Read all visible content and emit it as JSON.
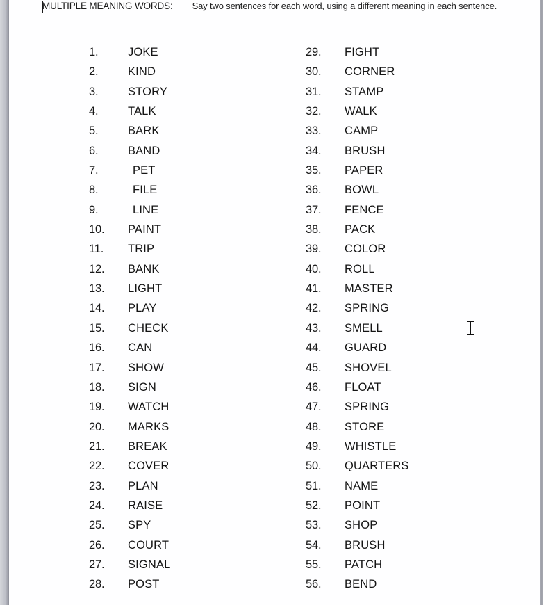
{
  "document": {
    "header": {
      "title": "MULTIPLE MEANING WORDS:",
      "instruction": "Say two sentences for each word, using a different meaning in each sentence."
    },
    "columns": [
      {
        "name": "left-column",
        "items": [
          {
            "number": "1.",
            "word": "JOKE",
            "indent": false
          },
          {
            "number": "2.",
            "word": "KIND",
            "indent": false
          },
          {
            "number": "3.",
            "word": "STORY",
            "indent": false
          },
          {
            "number": "4.",
            "word": "TALK",
            "indent": false
          },
          {
            "number": "5.",
            "word": "BARK",
            "indent": false
          },
          {
            "number": "6.",
            "word": "BAND",
            "indent": false
          },
          {
            "number": "7.",
            "word": "PET",
            "indent": true
          },
          {
            "number": "8.",
            "word": "FILE",
            "indent": true
          },
          {
            "number": "9.",
            "word": "LINE",
            "indent": true
          },
          {
            "number": "10.",
            "word": "PAINT",
            "indent": false
          },
          {
            "number": "11.",
            "word": "TRIP",
            "indent": false
          },
          {
            "number": "12.",
            "word": "BANK",
            "indent": false
          },
          {
            "number": "13.",
            "word": "LIGHT",
            "indent": false
          },
          {
            "number": "14.",
            "word": "PLAY",
            "indent": false
          },
          {
            "number": "15.",
            "word": "CHECK",
            "indent": false
          },
          {
            "number": "16.",
            "word": "CAN",
            "indent": false
          },
          {
            "number": "17.",
            "word": "SHOW",
            "indent": false
          },
          {
            "number": "18.",
            "word": "SIGN",
            "indent": false
          },
          {
            "number": "19.",
            "word": "WATCH",
            "indent": false
          },
          {
            "number": "20.",
            "word": "MARKS",
            "indent": false
          },
          {
            "number": "21.",
            "word": "BREAK",
            "indent": false
          },
          {
            "number": "22.",
            "word": "COVER",
            "indent": false
          },
          {
            "number": "23.",
            "word": "PLAN",
            "indent": false
          },
          {
            "number": "24.",
            "word": "RAISE",
            "indent": false
          },
          {
            "number": "25.",
            "word": "SPY",
            "indent": false
          },
          {
            "number": "26.",
            "word": "COURT",
            "indent": false
          },
          {
            "number": "27.",
            "word": "SIGNAL",
            "indent": false
          },
          {
            "number": "28.",
            "word": "POST",
            "indent": false
          }
        ]
      },
      {
        "name": "right-column",
        "items": [
          {
            "number": "29.",
            "word": "FIGHT",
            "indent": false
          },
          {
            "number": "30.",
            "word": "CORNER",
            "indent": false
          },
          {
            "number": "31.",
            "word": "STAMP",
            "indent": false
          },
          {
            "number": "32.",
            "word": "WALK",
            "indent": false
          },
          {
            "number": "33.",
            "word": "CAMP",
            "indent": false
          },
          {
            "number": "34.",
            "word": "BRUSH",
            "indent": false
          },
          {
            "number": "35.",
            "word": "PAPER",
            "indent": false
          },
          {
            "number": "36.",
            "word": "BOWL",
            "indent": false
          },
          {
            "number": "37.",
            "word": "FENCE",
            "indent": false
          },
          {
            "number": "38.",
            "word": "PACK",
            "indent": false
          },
          {
            "number": "39.",
            "word": "COLOR",
            "indent": false
          },
          {
            "number": "40.",
            "word": "ROLL",
            "indent": false
          },
          {
            "number": "41.",
            "word": "MASTER",
            "indent": false
          },
          {
            "number": "42.",
            "word": "SPRING",
            "indent": false
          },
          {
            "number": "43.",
            "word": "SMELL",
            "indent": false
          },
          {
            "number": "44.",
            "word": "GUARD",
            "indent": false
          },
          {
            "number": "45.",
            "word": "SHOVEL",
            "indent": false
          },
          {
            "number": "46.",
            "word": "FLOAT",
            "indent": false
          },
          {
            "number": "47.",
            "word": "SPRING",
            "indent": false
          },
          {
            "number": "48.",
            "word": "STORE",
            "indent": false
          },
          {
            "number": "49.",
            "word": "WHISTLE",
            "indent": false
          },
          {
            "number": "50.",
            "word": "QUARTERS",
            "indent": false
          },
          {
            "number": "51.",
            "word": "NAME",
            "indent": false
          },
          {
            "number": "52.",
            "word": "POINT",
            "indent": false
          },
          {
            "number": "53.",
            "word": "SHOP",
            "indent": false
          },
          {
            "number": "54.",
            "word": "BRUSH",
            "indent": false
          },
          {
            "number": "55.",
            "word": "PATCH",
            "indent": false
          },
          {
            "number": "56.",
            "word": "BEND",
            "indent": false
          }
        ]
      }
    ]
  },
  "cursors": {
    "text_caret": "text-caret",
    "mouse_pointer": "i-beam-cursor"
  },
  "colors": {
    "page_background": "#fefeff",
    "text": "#141414",
    "chrome_gray": "#9a9ca6"
  }
}
